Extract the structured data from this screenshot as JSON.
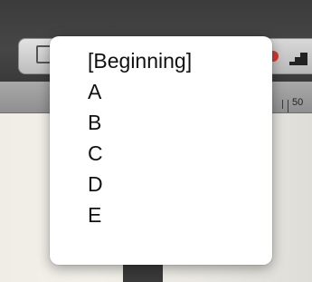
{
  "toolbar": {
    "left_icon": "text-box-icon",
    "record_icon": "record-icon",
    "right_icon": "stairs-icon"
  },
  "ruler": {
    "marker_label": "50"
  },
  "menu": {
    "items": [
      {
        "label": "[Beginning]"
      },
      {
        "label": "A"
      },
      {
        "label": "B"
      },
      {
        "label": "C"
      },
      {
        "label": "D"
      },
      {
        "label": "E"
      }
    ]
  },
  "colors": {
    "toolbar_background": "#3c3c3c",
    "menu_background": "#ffffff",
    "record_indicator": "#d23a30"
  }
}
